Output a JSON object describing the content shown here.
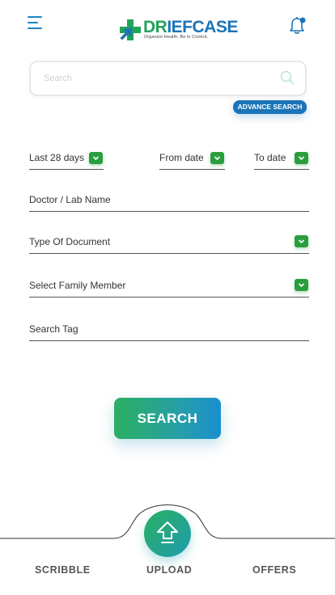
{
  "header": {
    "menu_icon": "hamburger-menu-icon",
    "logo_prefix": "DR",
    "logo_suffix": "IEFCASE",
    "logo_tagline": "Organize Health. Be in Control.",
    "notification_icon": "bell-icon"
  },
  "search": {
    "placeholder": "Search",
    "value": "",
    "icon": "search-icon",
    "advance_label": "ADVANCE SEARCH"
  },
  "filters": {
    "period": {
      "label": "Last 28 days",
      "icon": "chevron-down-icon"
    },
    "from_date": {
      "label": "From date",
      "icon": "chevron-down-icon"
    },
    "to_date": {
      "label": "To date",
      "icon": "chevron-down-icon"
    },
    "doctor": {
      "label": "Doctor / Lab Name"
    },
    "document_type": {
      "label": "Type Of Document",
      "icon": "chevron-down-icon"
    },
    "family_member": {
      "label": "Select Family Member",
      "icon": "chevron-down-icon"
    },
    "search_tag": {
      "label": "Search Tag"
    }
  },
  "actions": {
    "search_label": "SEARCH"
  },
  "bottom_nav": {
    "scribble": "SCRIBBLE",
    "upload": "UPLOAD",
    "offers": "OFFERS",
    "upload_icon": "upload-arrow-icon"
  },
  "colors": {
    "brand_blue": "#1b74b8",
    "brand_green": "#2a9e3e",
    "button_gradient_start": "#2bb061",
    "button_gradient_end": "#1b8fd0"
  }
}
